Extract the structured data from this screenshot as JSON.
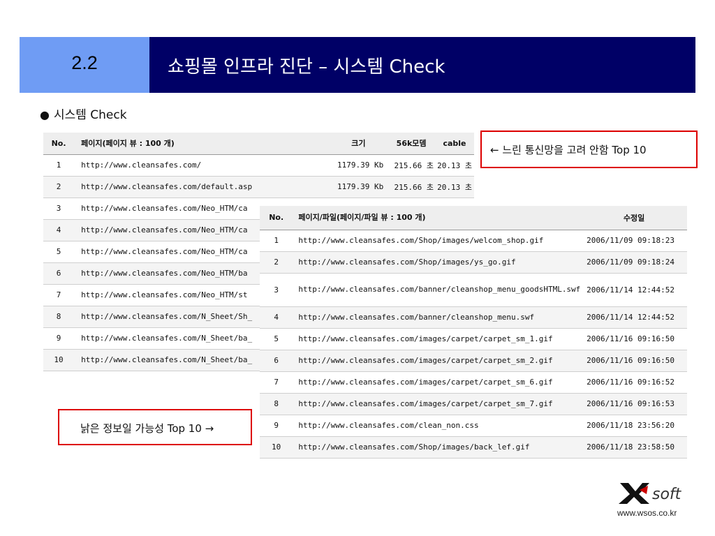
{
  "header": {
    "number": "2.2",
    "title": "쇼핑몰 인프라 진단 – 시스템 Check"
  },
  "section": {
    "bullet": "●",
    "label": "시스템 Check"
  },
  "table1": {
    "headers": {
      "no": "No.",
      "page": "페이지(페이지 뷰 : 100 개)",
      "size": "크기",
      "k56": "56k모뎀",
      "cable": "cable"
    },
    "rows": [
      {
        "no": "1",
        "url": "http://www.cleansafes.com/",
        "size": "1179.39 Kb",
        "k56": "215.66 초",
        "cable": "20.13 초"
      },
      {
        "no": "2",
        "url": "http://www.cleansafes.com/default.asp",
        "size": "1179.39 Kb",
        "k56": "215.66 초",
        "cable": "20.13 초"
      },
      {
        "no": "3",
        "url": "http://www.cleansafes.com/Neo_HTM/ca",
        "size": "",
        "k56": "",
        "cable": ""
      },
      {
        "no": "4",
        "url": "http://www.cleansafes.com/Neo_HTM/ca",
        "size": "",
        "k56": "",
        "cable": ""
      },
      {
        "no": "5",
        "url": "http://www.cleansafes.com/Neo_HTM/ca",
        "size": "",
        "k56": "",
        "cable": ""
      },
      {
        "no": "6",
        "url": "http://www.cleansafes.com/Neo_HTM/ba",
        "size": "",
        "k56": "",
        "cable": ""
      },
      {
        "no": "7",
        "url": "http://www.cleansafes.com/Neo_HTM/st",
        "size": "",
        "k56": "",
        "cable": ""
      },
      {
        "no": "8",
        "url": "http://www.cleansafes.com/N_Sheet/Sh_",
        "size": "",
        "k56": "",
        "cable": ""
      },
      {
        "no": "9",
        "url": "http://www.cleansafes.com/N_Sheet/ba_",
        "size": "",
        "k56": "",
        "cable": ""
      },
      {
        "no": "10",
        "url": "http://www.cleansafes.com/N_Sheet/ba_",
        "size": "",
        "k56": "",
        "cable": ""
      }
    ]
  },
  "table2": {
    "headers": {
      "no": "No.",
      "file": "페이지/파일(페이지/파일 뷰 : 100 개)",
      "date": "수정일"
    },
    "rows": [
      {
        "no": "1",
        "file": "http://www.cleansafes.com/Shop/images/welcom_shop.gif",
        "date": "2006/11/09 09:18:23"
      },
      {
        "no": "2",
        "file": "http://www.cleansafes.com/Shop/images/ys_go.gif",
        "date": "2006/11/09 09:18:24"
      },
      {
        "no": "3",
        "file": "http://www.cleansafes.com/banner/cleanshop_menu_goodsHTML.swf",
        "date": "2006/11/14 12:44:52"
      },
      {
        "no": "4",
        "file": "http://www.cleansafes.com/banner/cleanshop_menu.swf",
        "date": "2006/11/14 12:44:52"
      },
      {
        "no": "5",
        "file": "http://www.cleansafes.com/images/carpet/carpet_sm_1.gif",
        "date": "2006/11/16 09:16:50"
      },
      {
        "no": "6",
        "file": "http://www.cleansafes.com/images/carpet/carpet_sm_2.gif",
        "date": "2006/11/16 09:16:50"
      },
      {
        "no": "7",
        "file": "http://www.cleansafes.com/images/carpet/carpet_sm_6.gif",
        "date": "2006/11/16 09:16:52"
      },
      {
        "no": "8",
        "file": "http://www.cleansafes.com/images/carpet/carpet_sm_7.gif",
        "date": "2006/11/16 09:16:53"
      },
      {
        "no": "9",
        "file": "http://www.cleansafes.com/clean_non.css",
        "date": "2006/11/18 23:56:20"
      },
      {
        "no": "10",
        "file": "http://www.cleansafes.com/Shop/images/back_lef.gif",
        "date": "2006/11/18 23:58:50"
      }
    ]
  },
  "callouts": {
    "top": "← 느린 통신망을 고려 안함 Top 10",
    "bottom": "낡은 정보일 가능성 Top 10 →"
  },
  "logo": {
    "brand": "soft",
    "url": "www.wsos.co.kr"
  },
  "colors": {
    "header_left": "#6f9cf4",
    "header_right": "#000066",
    "callout_border": "#dd0000"
  }
}
